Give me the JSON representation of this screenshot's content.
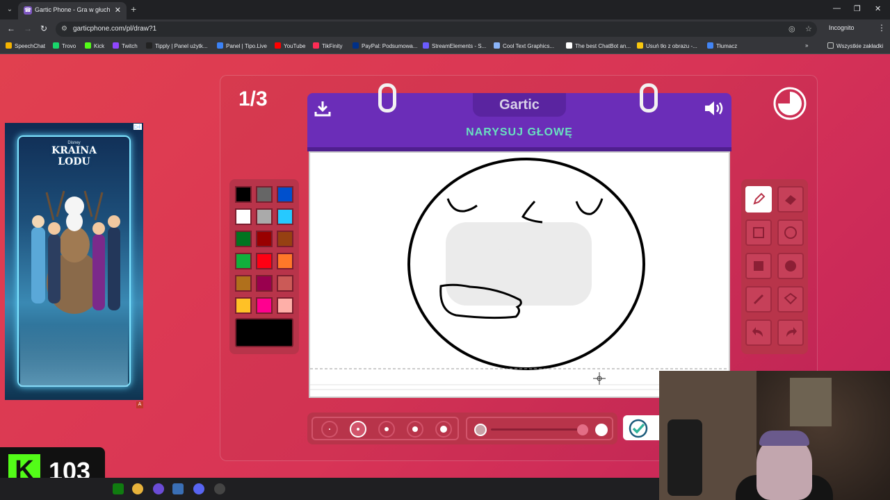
{
  "browser": {
    "tab_title": "Gartic Phone - Gra w głuchy te",
    "tab_close": "✕",
    "new_tab": "+",
    "url": "garticphone.com/pl/draw?1",
    "incognito_label": "Incognito",
    "window_controls": [
      "—",
      "❐",
      "✕"
    ],
    "bookmarks": [
      {
        "label": "SpeechChat",
        "color": "#f5b400"
      },
      {
        "label": "Trovo",
        "color": "#19d66b"
      },
      {
        "label": "Kick",
        "color": "#53fc18"
      },
      {
        "label": "Twitch",
        "color": "#9146ff"
      },
      {
        "label": "Tipply | Panel użytk...",
        "color": "#222222"
      },
      {
        "label": "Panel | Tipo.Live",
        "color": "#3b82f6"
      },
      {
        "label": "YouTube",
        "color": "#ff0000"
      },
      {
        "label": "TikFinity",
        "color": "#fe2c55"
      },
      {
        "label": "PayPal: Podsumowa...",
        "color": "#003087"
      },
      {
        "label": "StreamElements - S...",
        "color": "#6b5cff"
      },
      {
        "label": "Cool Text Graphics...",
        "color": "#8ab4f8"
      },
      {
        "label": "The best ChatBot an...",
        "color": "#ffffff"
      },
      {
        "label": "Usuń tło z obrazu -...",
        "color": "#f9c80e"
      },
      {
        "label": "Tłumacz",
        "color": "#4285f4"
      }
    ],
    "all_bookmarks": "Wszystkie zakładki"
  },
  "game": {
    "round": "1/3",
    "logo": "Gartic",
    "prompt": "NARYSUJ GŁOWĘ",
    "active_tool": "pencil",
    "selected_size_index": 1,
    "colors": [
      "#000000",
      "#666666",
      "#0050cd",
      "#ffffff",
      "#aaaaaa",
      "#26c9ff",
      "#017420",
      "#990000",
      "#964112",
      "#11b03c",
      "#ff0013",
      "#ff7829",
      "#b0701c",
      "#99004e",
      "#cb5a57",
      "#ffc126",
      "#ff008f",
      "#feafa8"
    ],
    "current_color": "#000000",
    "watermark": "Gartic PHONE"
  },
  "ad": {
    "brand": "Disney",
    "title_line1": "KRAINA",
    "title_line2": "LODU",
    "adchoices": "▷ⅰ",
    "marker": "A"
  },
  "kick": {
    "logo_letter": "K",
    "count": "103"
  }
}
